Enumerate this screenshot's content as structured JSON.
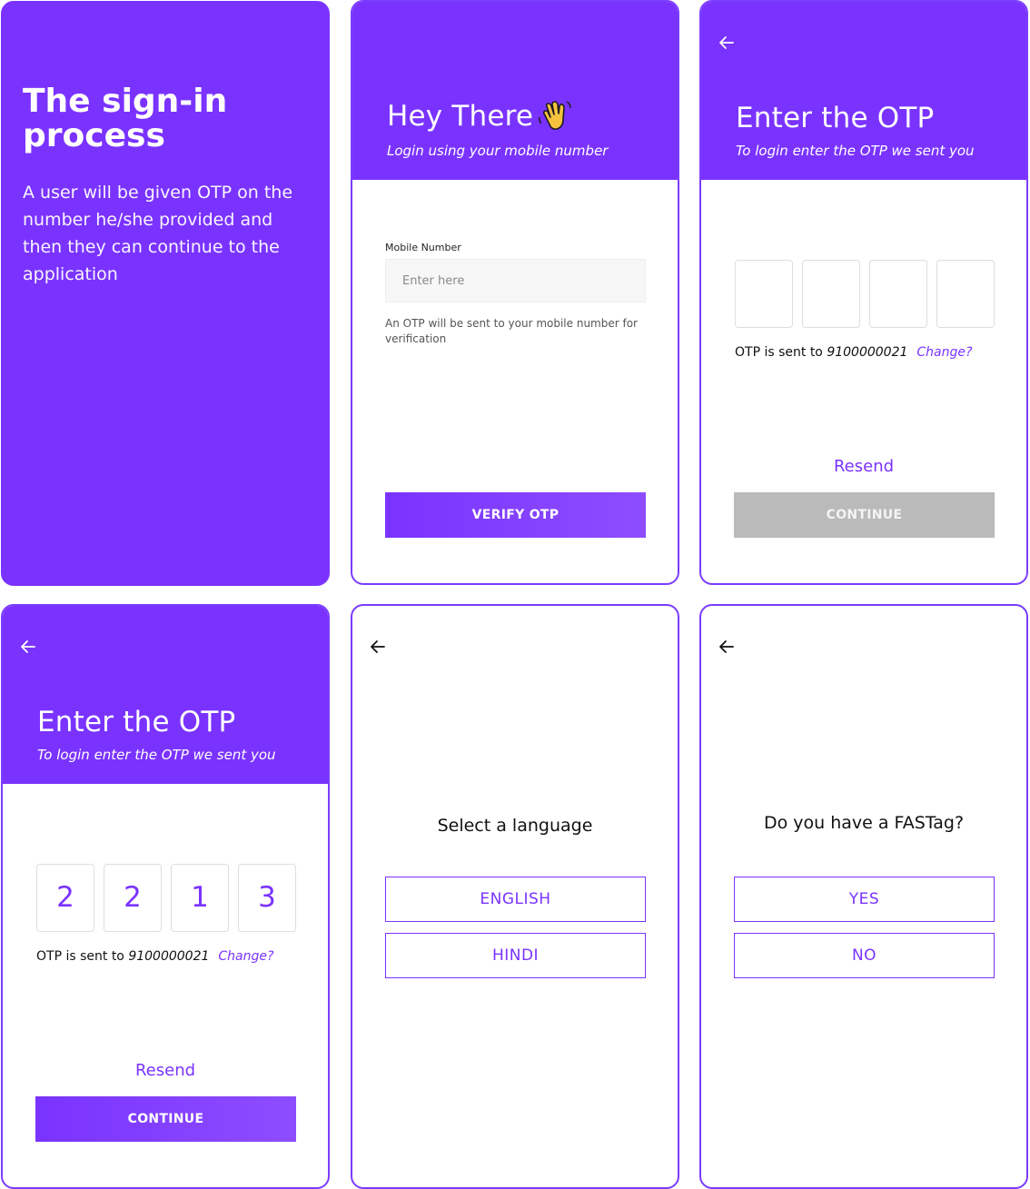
{
  "intro": {
    "title": "The sign-in process",
    "body": "A user will be given OTP on the number he/she provided and then they can continue to the application"
  },
  "login": {
    "title": "Hey There",
    "emoji_icon": "waving-hand-icon",
    "subtitle": "Login using your mobile number",
    "field_label": "Mobile Number",
    "field_placeholder": "Enter here",
    "field_value": "",
    "helper": "An OTP will be sent to your mobile number for verification",
    "button": "VERIFY OTP"
  },
  "otp_empty": {
    "back_icon": "arrow-left-icon",
    "title": "Enter the OTP",
    "subtitle": "To login enter the OTP we sent you",
    "digits": [
      "",
      "",
      "",
      ""
    ],
    "note_prefix": "OTP is sent to ",
    "phone": "9100000021",
    "change": "Change?",
    "resend": "Resend",
    "button": "CONTINUE"
  },
  "otp_filled": {
    "back_icon": "arrow-left-icon",
    "title": "Enter the OTP",
    "subtitle": "To login enter the OTP we sent you",
    "digits": [
      "2",
      "2",
      "1",
      "3"
    ],
    "note_prefix": "OTP is sent to ",
    "phone": "9100000021",
    "change": "Change?",
    "resend": "Resend",
    "button": "CONTINUE"
  },
  "language": {
    "back_icon": "arrow-left-icon",
    "question": "Select a language",
    "options": [
      "ENGLISH",
      "HINDI"
    ]
  },
  "fastag": {
    "back_icon": "arrow-left-icon",
    "question": "Do you have a FASTag?",
    "options": [
      "YES",
      "NO"
    ]
  },
  "colors": {
    "brand": "#7a33ff",
    "disabled_button": "#bababa",
    "input_bg": "#f7f7f7"
  }
}
